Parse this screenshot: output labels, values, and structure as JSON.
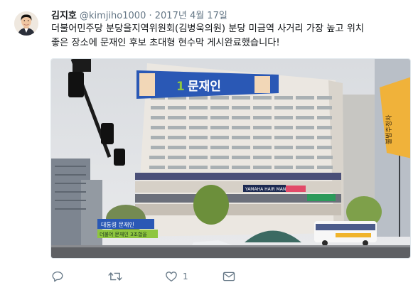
{
  "tweet": {
    "author_name": "김지호",
    "handle": "@kimjiho1000",
    "separator": "·",
    "date": "2017년 4월 17일",
    "text_line1": "더불어민주당 분당을지역위원회(김병욱의원) 분당 미금역 사거리 가장 높고 위치",
    "text_line2": "좋은 장소에 문재인 후보 초대형 현수막 게시완료했습니다!"
  },
  "photo": {
    "banner_number": "1",
    "banner_name": "문재인",
    "small_banner_1": "대통령 문재인",
    "small_banner_2": "더불어 문재인 3조합을",
    "side_sign": "불법주정차",
    "shop_sign": "YAMAHA HAIR MAN",
    "bus_sign": "HAIR"
  },
  "actions": {
    "reply_icon": "reply-icon",
    "retweet_icon": "retweet-icon",
    "like_icon": "heart-icon",
    "like_count": "1",
    "message_icon": "envelope-icon"
  },
  "colors": {
    "text": "#14171a",
    "muted": "#657786",
    "banner_blue": "#2a58b5",
    "banner_green": "#8ec63f"
  }
}
